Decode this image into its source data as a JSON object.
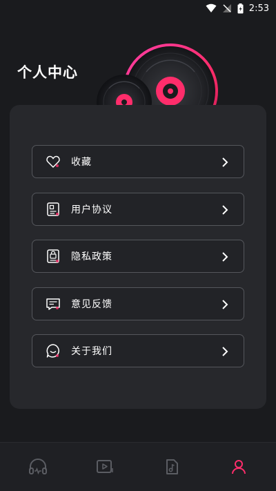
{
  "status_bar": {
    "time": "2:53",
    "icons": [
      "wifi-icon",
      "signal-icon",
      "battery-icon"
    ]
  },
  "header": {
    "title": "个人中心",
    "decoration": "vinyl-records-icon"
  },
  "menu": {
    "items": [
      {
        "label": "收藏",
        "icon": "heart-icon"
      },
      {
        "label": "用户协议",
        "icon": "document-icon"
      },
      {
        "label": "隐私政策",
        "icon": "lock-document-icon"
      },
      {
        "label": "意见反馈",
        "icon": "message-icon"
      },
      {
        "label": "关于我们",
        "icon": "smile-icon"
      }
    ]
  },
  "tabbar": {
    "tabs": [
      {
        "icon": "headphones-icon",
        "active": false
      },
      {
        "icon": "video-icon",
        "active": false
      },
      {
        "icon": "music-file-icon",
        "active": false
      },
      {
        "icon": "user-icon",
        "active": true
      }
    ]
  },
  "colors": {
    "background": "#1a1b1e",
    "card": "#27282c",
    "accent": "#ff2d6b",
    "tab_inactive": "#5b5d63"
  }
}
